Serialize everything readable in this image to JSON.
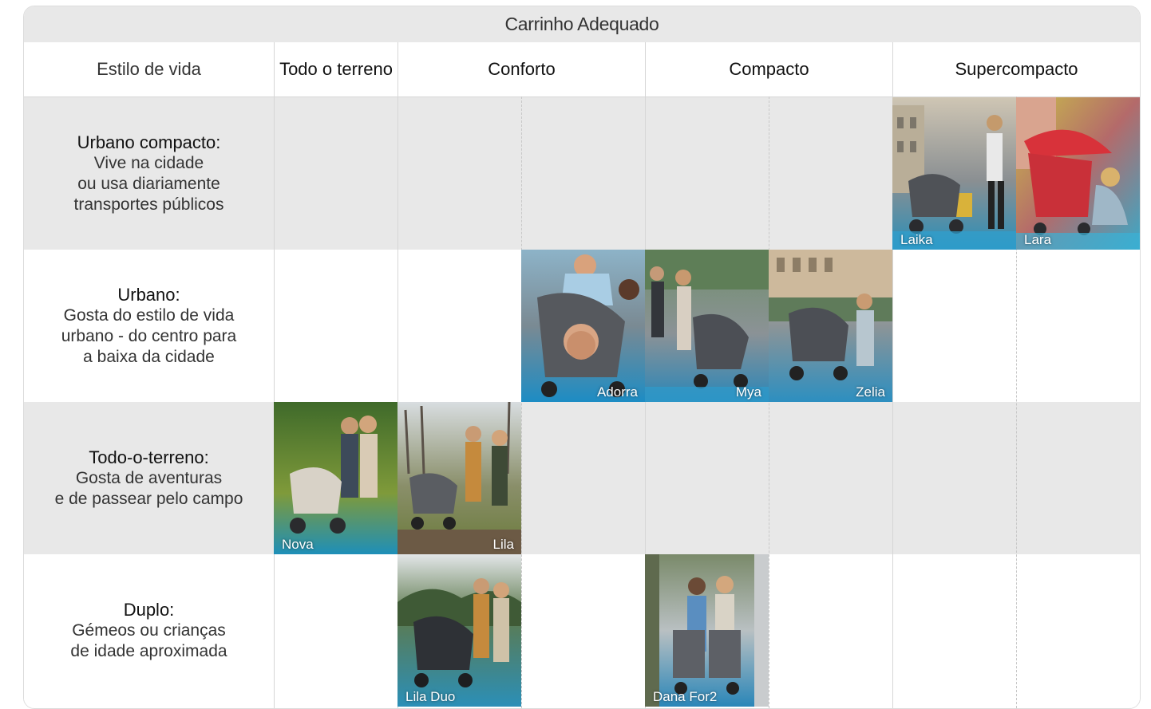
{
  "header": {
    "title": "Carrinho Adequado",
    "lifestyle_label": "Estilo de vida",
    "categories": [
      "Todo o terreno",
      "Conforto",
      "Compacto",
      "Supercompacto"
    ]
  },
  "rows": [
    {
      "title": "Urbano compacto:",
      "description": "Vive na cidade\nou usa diariamente\ntransportes públicos"
    },
    {
      "title": "Urbano:",
      "description": "Gosta do estilo de vida\nurbano - do centro para\na baixa da cidade"
    },
    {
      "title": "Todo-o-terreno:",
      "description": "Gosta de aventuras\ne de passear pelo campo"
    },
    {
      "title": "Duplo:",
      "description": "Gémeos ou crianças\nde idade aproximada"
    }
  ],
  "strollers": {
    "laika": "Laika",
    "lara": "Lara",
    "adorra": "Adorra",
    "mya": "Mya",
    "zelia": "Zelia",
    "nova": "Nova",
    "lila": "Lila",
    "lila_duo": "Lila Duo",
    "dana_for2": "Dana For2"
  },
  "colors": {
    "row_gray": "#e8e8e8",
    "grid_line": "#d6d6d6",
    "caption": "#ffffff"
  }
}
